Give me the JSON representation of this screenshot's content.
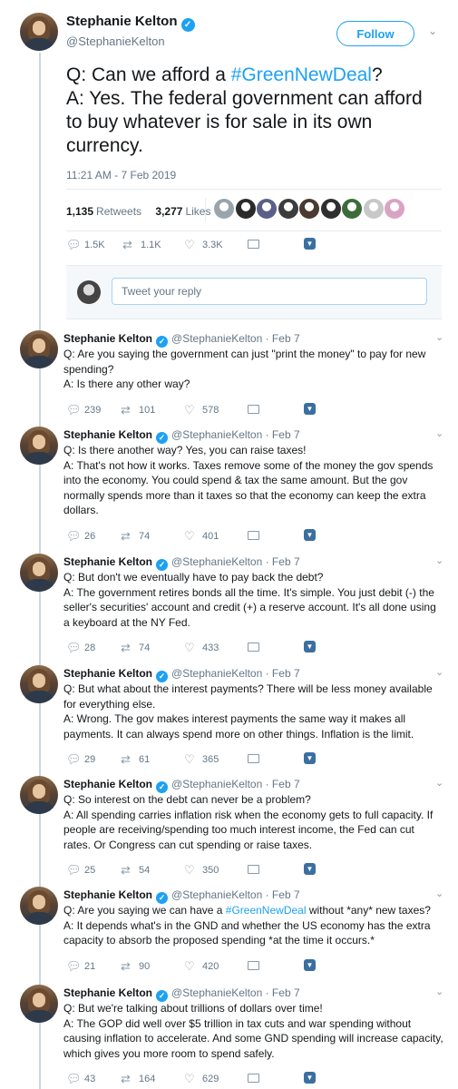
{
  "main_tweet": {
    "author_name": "Stephanie Kelton",
    "author_handle": "@StephanieKelton",
    "follow_label": "Follow",
    "chevron": "⌄",
    "text_line1_prefix": "Q: Can we afford a ",
    "text_line1_hashtag": "#GreenNewDeal",
    "text_line1_suffix": "?",
    "text_line2": "A: Yes. The federal government can afford to buy whatever is for sale in its own currency.",
    "timestamp": "11:21 AM - 7 Feb 2019",
    "retweets_count": "1,135",
    "retweets_label": "Retweets",
    "likes_count": "3,277",
    "likes_label": "Likes",
    "liker_colors": [
      "#9aa4ad",
      "#2b2b2b",
      "#5a5f8a",
      "#3c3c3c",
      "#4a3a30",
      "#2f2f2f",
      "#3d6b3a",
      "#c8c8c8",
      "#d9a3c6"
    ],
    "actions": {
      "replies": "1.5K",
      "retweets": "1.1K",
      "likes": "3.3K"
    }
  },
  "reply_box": {
    "placeholder": "Tweet your reply"
  },
  "icons": {
    "reply": "reply-icon",
    "retweet": "retweet-icon",
    "like": "heart-icon",
    "dm": "envelope-icon",
    "more": "chevron-down-icon",
    "verified": "verified-badge-icon"
  },
  "accent_color": "#1da1f2",
  "replies": [
    {
      "name": "Stephanie Kelton",
      "handle": "@StephanieKelton",
      "date": "· Feb 7",
      "lines": [
        {
          "text": "Q: Are you saying the government can just \"print the money\" to pay for new spending?"
        },
        {
          "text": "A: Is there any other way?"
        }
      ],
      "replies": "239",
      "retweets": "101",
      "likes": "578"
    },
    {
      "name": "Stephanie Kelton",
      "handle": "@StephanieKelton",
      "date": "· Feb 7",
      "lines": [
        {
          "text": "Q: Is there another way? Yes, you can raise taxes!"
        },
        {
          "text": "A: That's not how it works. Taxes remove some of the money the gov spends into the economy. You could spend & tax the same amount. But the gov normally spends more than it taxes so that the economy can keep the extra dollars."
        }
      ],
      "replies": "26",
      "retweets": "74",
      "likes": "401"
    },
    {
      "name": "Stephanie Kelton",
      "handle": "@StephanieKelton",
      "date": "· Feb 7",
      "lines": [
        {
          "text": "Q: But don't we eventually have to pay back the debt?"
        },
        {
          "text": "A: The government retires bonds all the time. It's simple. You just debit (-) the seller's securities' account and credit (+) a reserve account. It's all done using a keyboard at the NY Fed."
        }
      ],
      "replies": "28",
      "retweets": "74",
      "likes": "433"
    },
    {
      "name": "Stephanie Kelton",
      "handle": "@StephanieKelton",
      "date": "· Feb 7",
      "lines": [
        {
          "text": "Q: But what about the interest payments? There will be less money available for everything else."
        },
        {
          "text": "A: Wrong. The gov makes interest payments the same way it makes all payments. It can always spend more on other things. Inflation is the limit."
        }
      ],
      "replies": "29",
      "retweets": "61",
      "likes": "365"
    },
    {
      "name": "Stephanie Kelton",
      "handle": "@StephanieKelton",
      "date": "· Feb 7",
      "lines": [
        {
          "text": "Q: So interest on the debt can never be a problem?"
        },
        {
          "text": "A: All spending carries inflation risk when the economy gets to full capacity. If people are receiving/spending too much interest income, the Fed can cut rates. Or Congress can cut spending or raise taxes."
        }
      ],
      "replies": "25",
      "retweets": "54",
      "likes": "350"
    },
    {
      "name": "Stephanie Kelton",
      "handle": "@StephanieKelton",
      "date": "· Feb 7",
      "lines": [
        {
          "prefix": "Q: Are you saying we can have a ",
          "hashtag": "#GreenNewDeal",
          "text": " without *any* new taxes?"
        },
        {
          "text": "A: It depends what's in the GND and whether the US economy has the extra capacity to absorb the proposed spending *at the time it occurs.*"
        }
      ],
      "replies": "21",
      "retweets": "90",
      "likes": "420"
    },
    {
      "name": "Stephanie Kelton",
      "handle": "@StephanieKelton",
      "date": "· Feb 7",
      "lines": [
        {
          "text": "Q: But we're talking about trillions of dollars over time!"
        },
        {
          "text": "A: The GOP did well over $5 trillion in tax cuts and war spending without causing inflation to accelerate. And some GND spending will increase capacity, which gives you more room to spend safely."
        }
      ],
      "replies": "43",
      "retweets": "164",
      "likes": "629"
    }
  ]
}
